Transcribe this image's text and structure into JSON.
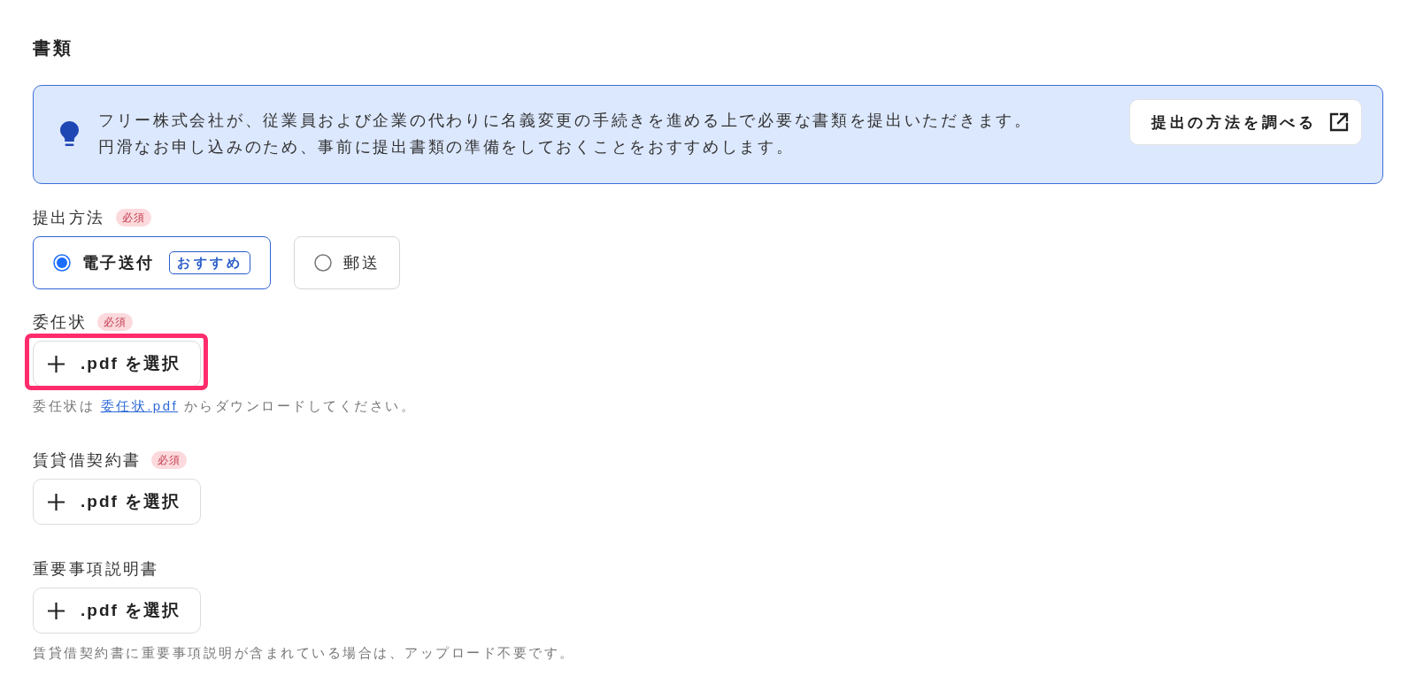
{
  "section_title": "書類",
  "info": {
    "lines": [
      "フリー株式会社が、従業員および企業の代わりに名義変更の手続きを進める上で必要な書類を提出いただきます。",
      "円滑なお申し込みのため、事前に提出書類の準備をしておくことをおすすめします。"
    ],
    "button": "提出の方法を調べる"
  },
  "fields": [
    {
      "kind": "radio",
      "label": "提出方法",
      "badge": "必須",
      "options": [
        {
          "label": "電子送付",
          "tag": "おすすめ",
          "selected": true
        },
        {
          "label": "郵送",
          "selected": false
        }
      ]
    },
    {
      "kind": "file",
      "label": "委任状",
      "badge": "必須",
      "button": ".pdf を選択",
      "highlighted": true,
      "hint": [
        {
          "kind": "text",
          "text": "委任状は "
        },
        {
          "kind": "link",
          "text": "委任状.pdf"
        },
        {
          "kind": "text",
          "text": " からダウンロードしてください。"
        }
      ]
    },
    {
      "kind": "file",
      "label": "賃貸借契約書",
      "badge": "必須",
      "button": ".pdf を選択",
      "highlighted": false
    },
    {
      "kind": "file",
      "label": "重要事項説明書",
      "button": ".pdf を選択",
      "highlighted": false,
      "hint": [
        {
          "kind": "text",
          "text": "賃貸借契約書に重要事項説明が含まれている場合は、アップロード不要です。"
        }
      ]
    }
  ]
}
